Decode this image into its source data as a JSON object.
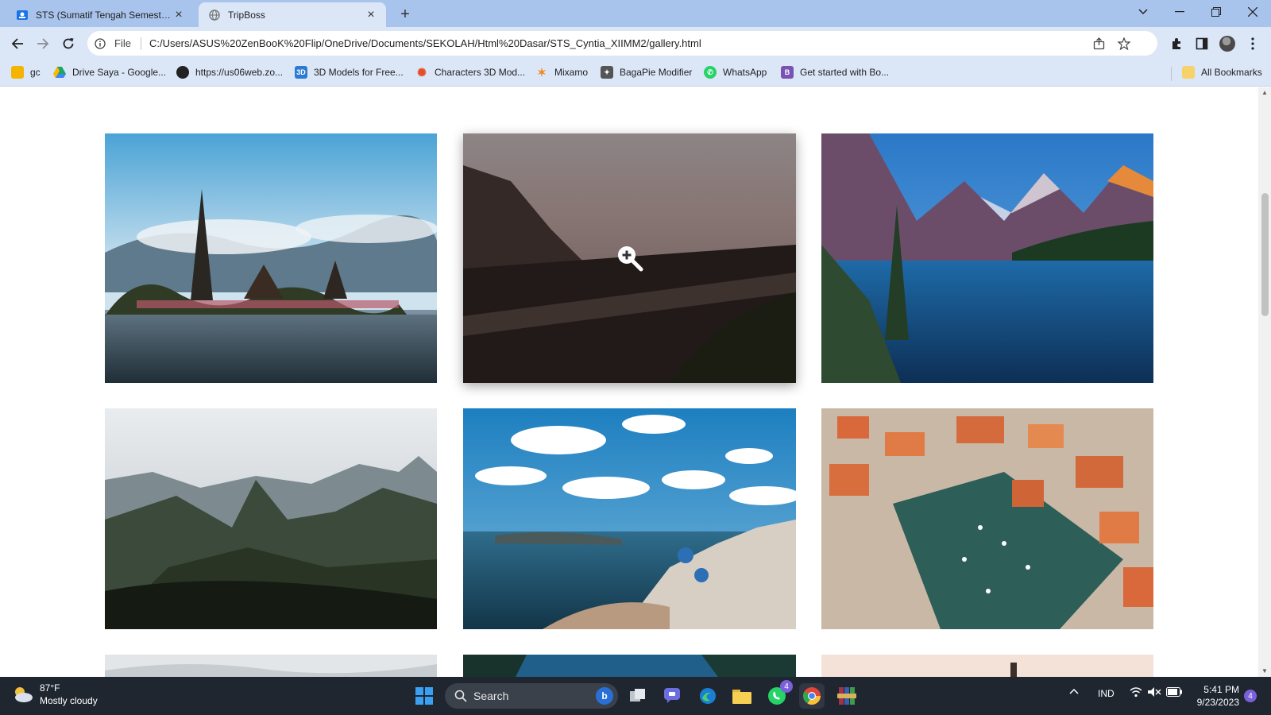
{
  "browser": {
    "tabs": [
      {
        "title": "STS (Sumatif Tengah Semester) C",
        "active": false
      },
      {
        "title": "TripBoss",
        "active": true
      }
    ],
    "address": {
      "scheme_label": "File",
      "url": "C:/Users/ASUS%20ZenBooK%20Flip/OneDrive/Documents/SEKOLAH/Html%20Dasar/STS_Cyntia_XIIMM2/gallery.html"
    },
    "bookmarks": [
      {
        "label": "gc",
        "icon": "classroom-icon",
        "color": "#f5b400"
      },
      {
        "label": "Drive Saya - Google...",
        "icon": "drive-icon",
        "color": "#1fa463"
      },
      {
        "label": "https://us06web.zo...",
        "icon": "globe-icon",
        "color": "#222222"
      },
      {
        "label": "3D Models for Free...",
        "icon": "3d-icon",
        "color": "#2d7bd1"
      },
      {
        "label": "Characters 3D Mod...",
        "icon": "mixamo-char-icon",
        "color": "#e44d26"
      },
      {
        "label": "Mixamo",
        "icon": "mixamo-icon",
        "color": "#f08a24"
      },
      {
        "label": "BagaPie Modifier",
        "icon": "bagapie-icon",
        "color": "#555555"
      },
      {
        "label": "WhatsApp",
        "icon": "whatsapp-icon",
        "color": "#25d366"
      },
      {
        "label": "Get started with Bo...",
        "icon": "bootstrap-icon",
        "color": "#7952b3"
      }
    ],
    "all_bookmarks_label": "All Bookmarks"
  },
  "gallery": {
    "photos": [
      {
        "name": "bali-temple-photo",
        "hover": false
      },
      {
        "name": "coastal-cliff-photo",
        "hover": true
      },
      {
        "name": "mountain-lake-photo",
        "hover": false
      },
      {
        "name": "machu-picchu-photo",
        "hover": false
      },
      {
        "name": "santorini-photo",
        "hover": false
      },
      {
        "name": "harbor-town-photo",
        "hover": false
      },
      {
        "name": "bottom-left-photo",
        "hover": false
      },
      {
        "name": "bottom-middle-photo",
        "hover": false
      },
      {
        "name": "bottom-right-photo",
        "hover": false
      }
    ]
  },
  "taskbar": {
    "weather": {
      "temp": "87°F",
      "condition": "Mostly cloudy"
    },
    "search_label": "Search",
    "whatsapp_badge": "4",
    "language": "IND",
    "time": "5:41 PM",
    "date": "9/23/2023",
    "notification_count": "4"
  }
}
